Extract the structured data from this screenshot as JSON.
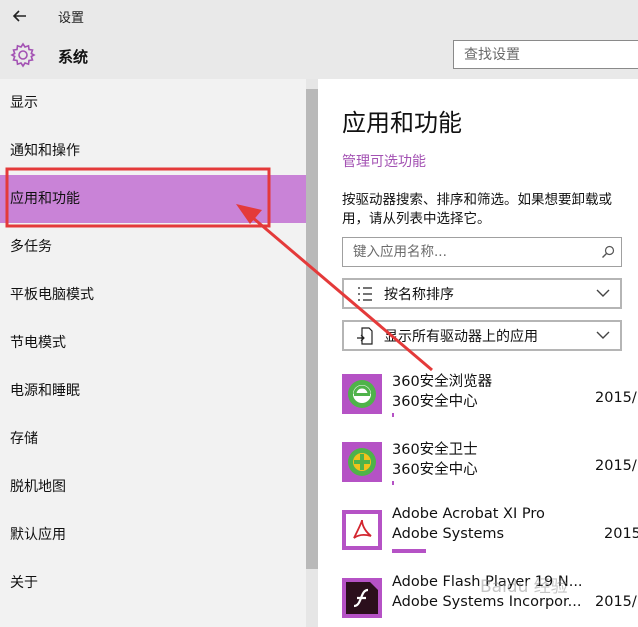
{
  "window": {
    "title": "设置"
  },
  "header": {
    "section_title": "系统",
    "search_placeholder": "查找设置"
  },
  "sidebar": {
    "items": [
      {
        "label": "显示"
      },
      {
        "label": "通知和操作"
      },
      {
        "label": "应用和功能",
        "selected": true
      },
      {
        "label": "多任务"
      },
      {
        "label": "平板电脑模式"
      },
      {
        "label": "节电模式"
      },
      {
        "label": "电源和睡眠"
      },
      {
        "label": "存储"
      },
      {
        "label": "脱机地图"
      },
      {
        "label": "默认应用"
      },
      {
        "label": "关于"
      }
    ]
  },
  "main": {
    "title": "应用和功能",
    "manage_link": "管理可选功能",
    "description": "按驱动器搜索、排序和筛选。如果想要卸载或\n用，请从列表中选择它。",
    "app_search_placeholder": "键入应用名称...",
    "sort_label": "按名称排序",
    "filter_label": "显示所有驱动器上的应用",
    "apps": [
      {
        "name": "360安全浏览器",
        "publisher": "360安全中心",
        "date": "2015/",
        "size_bar_fraction": 0.01
      },
      {
        "name": "360安全卫士",
        "publisher": "360安全中心",
        "date": "2015/",
        "size_bar_fraction": 0.01
      },
      {
        "name": "Adobe Acrobat XI Pro",
        "publisher": "Adobe Systems",
        "date": "2015",
        "size_bar_fraction": 0.13
      },
      {
        "name": "Adobe Flash Player 19 N...",
        "publisher": "Adobe Systems Incorpor...",
        "date": "2015/"
      }
    ]
  },
  "watermark": "Baidu 经验",
  "colors": {
    "accent": "#c983d7",
    "link": "#a352b3",
    "annotation": "#e43a3a"
  }
}
